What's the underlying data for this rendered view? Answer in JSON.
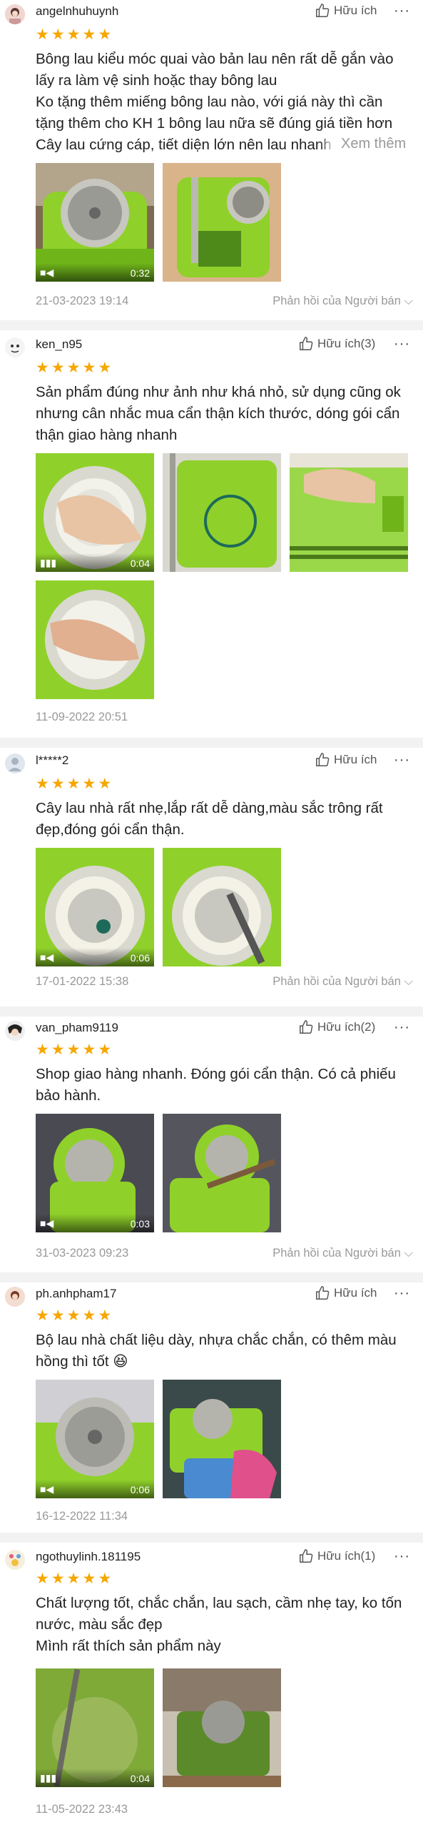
{
  "colors": {
    "star": "#f6a700",
    "mop_green": "#8fd12a",
    "separator": "#f2f2f2"
  },
  "reviews": [
    {
      "username": "angelnhuhuynh",
      "likes": "Hữu ích",
      "stars": 5,
      "lines": [
        "Bông lau kiểu móc quai vào bản lau nên rất dễ gắn vào",
        "lấy ra làm vệ sinh hoặc thay bông lau",
        "Ko tặng thêm miếng bông lau nào, với giá này thì cần",
        "tặng thêm cho KH 1 bông lau nữa sẽ đúng giá tiền hơn",
        "Cây lau cứng cáp, tiết diện lớn nên lau nhanh"
      ],
      "see_more": "Xem thêm",
      "media": [
        {
          "type": "video",
          "duration": "0:32"
        },
        {
          "type": "image"
        }
      ],
      "date": "21-03-2023 19:14",
      "reply": "Phản hồi của Người bán"
    },
    {
      "username": "ken_n95",
      "likes": "Hữu ích(3)",
      "stars": 5,
      "lines": [
        "Sản phẩm đúng như ảnh như khá nhỏ, sử dụng cũng ok",
        "nhưng cân nhắc mua cẩn thận kích thước, dóng gói cẩn",
        "thận giao hàng nhanh"
      ],
      "media": [
        {
          "type": "video",
          "duration": "0:04"
        },
        {
          "type": "image"
        },
        {
          "type": "image"
        },
        {
          "type": "image"
        }
      ],
      "date": "11-09-2022 20:51"
    },
    {
      "username": "l*****2",
      "likes": "Hữu ích",
      "stars": 5,
      "lines": [
        "Cây lau nhà rất nhẹ,lắp rất dễ dàng,màu sắc trông rất",
        "đẹp,đóng gói cẩn thận."
      ],
      "media": [
        {
          "type": "video",
          "duration": "0:06"
        },
        {
          "type": "image"
        }
      ],
      "date": "17-01-2022 15:38",
      "reply": "Phản hồi của Người bán"
    },
    {
      "username": "van_pham9119",
      "likes": "Hữu ích(2)",
      "stars": 5,
      "lines": [
        "Shop giao hàng nhanh. Đóng gói cẩn thận. Có cả phiếu",
        "bảo hành."
      ],
      "media": [
        {
          "type": "video",
          "duration": "0:03"
        },
        {
          "type": "image"
        }
      ],
      "date": "31-03-2023 09:23",
      "reply": "Phản hồi của Người bán"
    },
    {
      "username": "ph.anhpham17",
      "likes": "Hữu ích",
      "stars": 5,
      "lines": [
        "Bộ lau nhà chất liệu dày, nhựa chắc chắn, có thêm màu",
        "hồng thì tốt 😆"
      ],
      "media": [
        {
          "type": "video",
          "duration": "0:06"
        },
        {
          "type": "image"
        }
      ],
      "date": "16-12-2022 11:34"
    },
    {
      "username": "ngothuylinh.181195",
      "likes": "Hữu ích(1)",
      "stars": 5,
      "lines": [
        "Chất lượng tốt, chắc chắn, lau sạch, cầm nhẹ tay, ko tốn",
        "nước, màu sắc đẹp",
        "Mình rất thích sản phẩm này"
      ],
      "media": [
        {
          "type": "video",
          "duration": "0:04"
        },
        {
          "type": "image"
        }
      ],
      "date": "11-05-2022 23:43"
    }
  ]
}
